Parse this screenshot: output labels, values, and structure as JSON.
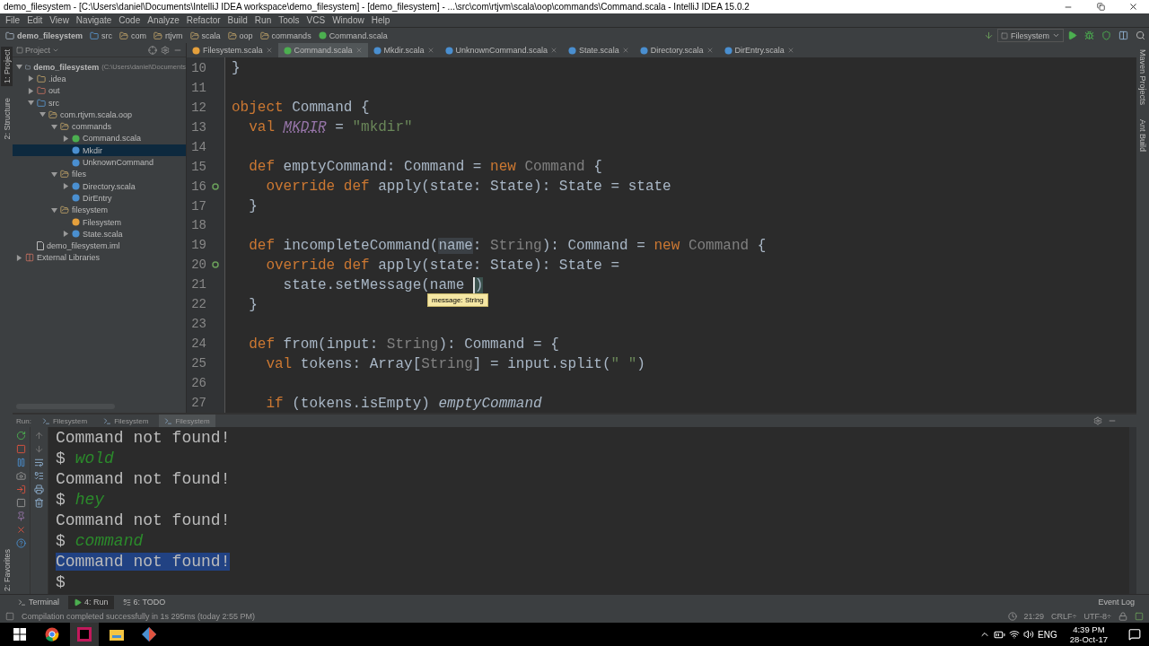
{
  "window": {
    "title": "demo_filesystem - [C:\\Users\\daniel\\Documents\\IntelliJ IDEA workspace\\demo_filesystem] - [demo_filesystem] - ...\\src\\com\\rtjvm\\scala\\oop\\commands\\Command.scala - IntelliJ IDEA 15.0.2"
  },
  "menu": [
    "File",
    "Edit",
    "View",
    "Navigate",
    "Code",
    "Analyze",
    "Refactor",
    "Build",
    "Run",
    "Tools",
    "VCS",
    "Window",
    "Help"
  ],
  "breadcrumbs": [
    {
      "label": "demo_filesystem",
      "kind": "module"
    },
    {
      "label": "src",
      "kind": "source"
    },
    {
      "label": "com",
      "kind": "package"
    },
    {
      "label": "rtjvm",
      "kind": "package"
    },
    {
      "label": "scala",
      "kind": "package"
    },
    {
      "label": "oop",
      "kind": "package"
    },
    {
      "label": "commands",
      "kind": "package"
    },
    {
      "label": "Command.scala",
      "kind": "trait"
    }
  ],
  "run_config": {
    "label": "Filesystem"
  },
  "tool_strip_left": [
    {
      "label": "1: Project",
      "selected": true
    },
    {
      "label": "2: Structure",
      "selected": false
    }
  ],
  "favorites": "2: Favorites",
  "tool_strip_right": [
    "Maven Projects",
    "Ant Build"
  ],
  "project_panel": {
    "title": "Project",
    "tree": [
      {
        "label": "demo_filesystem",
        "note": "(C:\\Users\\daniel\\Documents",
        "kind": "module",
        "expanded": true,
        "selected": false,
        "children": [
          {
            "label": ".idea",
            "kind": "folder",
            "expanded": false,
            "selected": false
          },
          {
            "label": "out",
            "kind": "excluded",
            "expanded": false,
            "selected": false
          },
          {
            "label": "src",
            "kind": "source",
            "expanded": true,
            "selected": false,
            "children": [
              {
                "label": "com.rtjvm.scala.oop",
                "kind": "package",
                "expanded": true,
                "selected": false,
                "children": [
                  {
                    "label": "commands",
                    "kind": "package",
                    "expanded": true,
                    "selected": false,
                    "children": [
                      {
                        "label": "Command.scala",
                        "kind": "trait",
                        "expanded": false,
                        "selected": false
                      },
                      {
                        "label": "Mkdir",
                        "kind": "class",
                        "selected": true
                      },
                      {
                        "label": "UnknownCommand",
                        "kind": "class",
                        "selected": false
                      }
                    ]
                  },
                  {
                    "label": "files",
                    "kind": "package",
                    "expanded": true,
                    "selected": false,
                    "children": [
                      {
                        "label": "Directory.scala",
                        "kind": "class",
                        "expanded": false,
                        "selected": false
                      },
                      {
                        "label": "DirEntry",
                        "kind": "class",
                        "selected": false
                      }
                    ]
                  },
                  {
                    "label": "filesystem",
                    "kind": "package",
                    "expanded": true,
                    "selected": false,
                    "children": [
                      {
                        "label": "Filesystem",
                        "kind": "object",
                        "selected": false
                      },
                      {
                        "label": "State.scala",
                        "kind": "class",
                        "expanded": false,
                        "selected": false
                      }
                    ]
                  }
                ]
              }
            ]
          },
          {
            "label": "demo_filesystem.iml",
            "kind": "file",
            "selected": false
          }
        ]
      },
      {
        "label": "External Libraries",
        "kind": "library",
        "expanded": false,
        "selected": false
      }
    ]
  },
  "editor_tabs": [
    {
      "label": "Filesystem.scala",
      "kind": "object",
      "selected": false
    },
    {
      "label": "Command.scala",
      "kind": "trait",
      "selected": true
    },
    {
      "label": "Mkdir.scala",
      "kind": "class",
      "selected": false
    },
    {
      "label": "UnknownCommand.scala",
      "kind": "class",
      "selected": false
    },
    {
      "label": "State.scala",
      "kind": "class",
      "selected": false
    },
    {
      "label": "Directory.scala",
      "kind": "class",
      "selected": false
    },
    {
      "label": "DirEntry.scala",
      "kind": "class",
      "selected": false
    }
  ],
  "code_lines": [
    {
      "n": "10",
      "override": false,
      "tokens": [
        {
          "t": "}",
          "kind": "plain"
        }
      ]
    },
    {
      "n": "11",
      "override": false
    },
    {
      "n": "12",
      "override": false,
      "tokens": [
        {
          "t": "object",
          "kind": "keyword"
        },
        {
          "t": " Command {",
          "kind": "plain"
        }
      ]
    },
    {
      "n": "13",
      "override": false,
      "tokens": [
        {
          "t": "  val ",
          "kind": "keyword"
        },
        {
          "t": "MKDIR",
          "kind": "constant"
        },
        {
          "t": " = ",
          "kind": "plain"
        },
        {
          "t": "\"mkdir\"",
          "kind": "string"
        }
      ]
    },
    {
      "n": "14",
      "override": false
    },
    {
      "n": "15",
      "override": false,
      "tokens": [
        {
          "t": "  def",
          "kind": "keyword"
        },
        {
          "t": " emptyCommand: Command = ",
          "kind": "plain"
        },
        {
          "t": "new ",
          "kind": "keyword"
        },
        {
          "t": "Command",
          "kind": "dim"
        },
        {
          "t": " {",
          "kind": "plain"
        }
      ]
    },
    {
      "n": "16",
      "override": true,
      "tokens": [
        {
          "t": "    override def",
          "kind": "keyword"
        },
        {
          "t": " apply(state: State): State = state",
          "kind": "plain"
        }
      ]
    },
    {
      "n": "17",
      "override": false,
      "tokens": [
        {
          "t": "  }",
          "kind": "plain"
        }
      ]
    },
    {
      "n": "18",
      "override": false
    },
    {
      "n": "19",
      "override": false,
      "tokens": [
        {
          "t": "  def",
          "kind": "keyword"
        },
        {
          "t": " incompleteCommand(",
          "kind": "plain"
        },
        {
          "t": "name",
          "kind": "match"
        },
        {
          "t": ": ",
          "kind": "plain"
        },
        {
          "t": "String",
          "kind": "dim"
        },
        {
          "t": "): Command = ",
          "kind": "plain"
        },
        {
          "t": "new ",
          "kind": "keyword"
        },
        {
          "t": "Command",
          "kind": "dim"
        },
        {
          "t": " {",
          "kind": "plain"
        }
      ]
    },
    {
      "n": "20",
      "override": true,
      "tokens": [
        {
          "t": "    override def",
          "kind": "keyword"
        },
        {
          "t": " apply(state: State): State =",
          "kind": "plain"
        }
      ]
    },
    {
      "n": "21",
      "override": false,
      "tooltip": "message: String",
      "tokens": [
        {
          "t": "      state.setMessage(name ",
          "kind": "plain"
        },
        {
          "t": ")",
          "kind": "caret"
        }
      ]
    },
    {
      "n": "22",
      "override": false,
      "tokens": [
        {
          "t": "  }",
          "kind": "plain"
        }
      ]
    },
    {
      "n": "23",
      "override": false
    },
    {
      "n": "24",
      "override": false,
      "tokens": [
        {
          "t": "  def",
          "kind": "keyword"
        },
        {
          "t": " from(input: ",
          "kind": "plain"
        },
        {
          "t": "String",
          "kind": "dim"
        },
        {
          "t": "): Command = {",
          "kind": "plain"
        }
      ]
    },
    {
      "n": "25",
      "override": false,
      "tokens": [
        {
          "t": "    val",
          "kind": "keyword"
        },
        {
          "t": " tokens: Array[",
          "kind": "plain"
        },
        {
          "t": "String",
          "kind": "dim"
        },
        {
          "t": "] = input.split(",
          "kind": "plain"
        },
        {
          "t": "\" \"",
          "kind": "string"
        },
        {
          "t": ")",
          "kind": "plain"
        }
      ]
    },
    {
      "n": "26",
      "override": false
    },
    {
      "n": "27",
      "override": false,
      "tokens": [
        {
          "t": "    if",
          "kind": "keyword"
        },
        {
          "t": " (tokens.isEmpty) ",
          "kind": "plain"
        },
        {
          "t": "emptyCommand",
          "kind": "italic"
        }
      ]
    }
  ],
  "run_panel": {
    "label": "Run:",
    "tabs": [
      {
        "label": "Filesystem",
        "selected": false
      },
      {
        "label": "Filesystem",
        "selected": false
      },
      {
        "label": "Filesystem",
        "selected": true
      }
    ],
    "console": [
      {
        "kind": "output",
        "text": "Command not found!",
        "selected": false
      },
      {
        "kind": "prompt",
        "text": "$",
        "input": "wold",
        "selected": false
      },
      {
        "kind": "output",
        "text": "Command not found!",
        "selected": false
      },
      {
        "kind": "prompt",
        "text": "$",
        "input": "hey",
        "selected": false
      },
      {
        "kind": "output",
        "text": "Command not found!",
        "selected": false
      },
      {
        "kind": "prompt",
        "text": "$",
        "input": "command",
        "selected": false
      },
      {
        "kind": "output",
        "text": "Command not found!",
        "selected": true
      },
      {
        "kind": "prompt",
        "text": "$",
        "selected": false
      }
    ]
  },
  "bottom_tabs": [
    {
      "label": "Terminal",
      "kind": "terminal",
      "selected": false
    },
    {
      "label": "4: Run",
      "kind": "run",
      "selected": true
    },
    {
      "label": "6: TODO",
      "kind": "todo",
      "selected": false
    }
  ],
  "event_log": "Event Log",
  "status_bar": {
    "message": "Compilation completed successfully in 1s 295ms (today 2:55 PM)",
    "position": "21:29",
    "line_separator": "CRLF÷",
    "encoding": "UTF-8÷"
  },
  "taskbar": {
    "language": "ENG",
    "time": "4:39 PM",
    "date": "28-Oct-17"
  }
}
